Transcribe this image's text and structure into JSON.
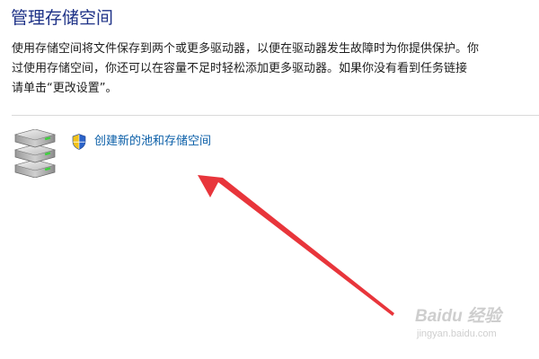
{
  "header": {
    "title": "管理存储空间"
  },
  "description": {
    "line1": "使用存储空间将文件保存到两个或更多驱动器，以便在驱动器发生故障时为你提供保护。你",
    "line2": "过使用存储空间，你还可以在容量不足时轻松添加更多驱动器。如果你没有看到任务链接",
    "line3": "请单击“更改设置”。"
  },
  "tasks": {
    "create_pool": {
      "label": "创建新的池和存储空间",
      "icon": "shield-icon"
    }
  },
  "icons": {
    "main": "drive-stack-icon",
    "annotation": "red-arrow"
  },
  "watermark": {
    "brand": "Baidu 经验",
    "domain": "jingyan.baidu.com"
  },
  "colors": {
    "title": "#1e3287",
    "link": "#0b5fa8",
    "arrow": "#e8353b",
    "divider": "#d9d9d9"
  }
}
